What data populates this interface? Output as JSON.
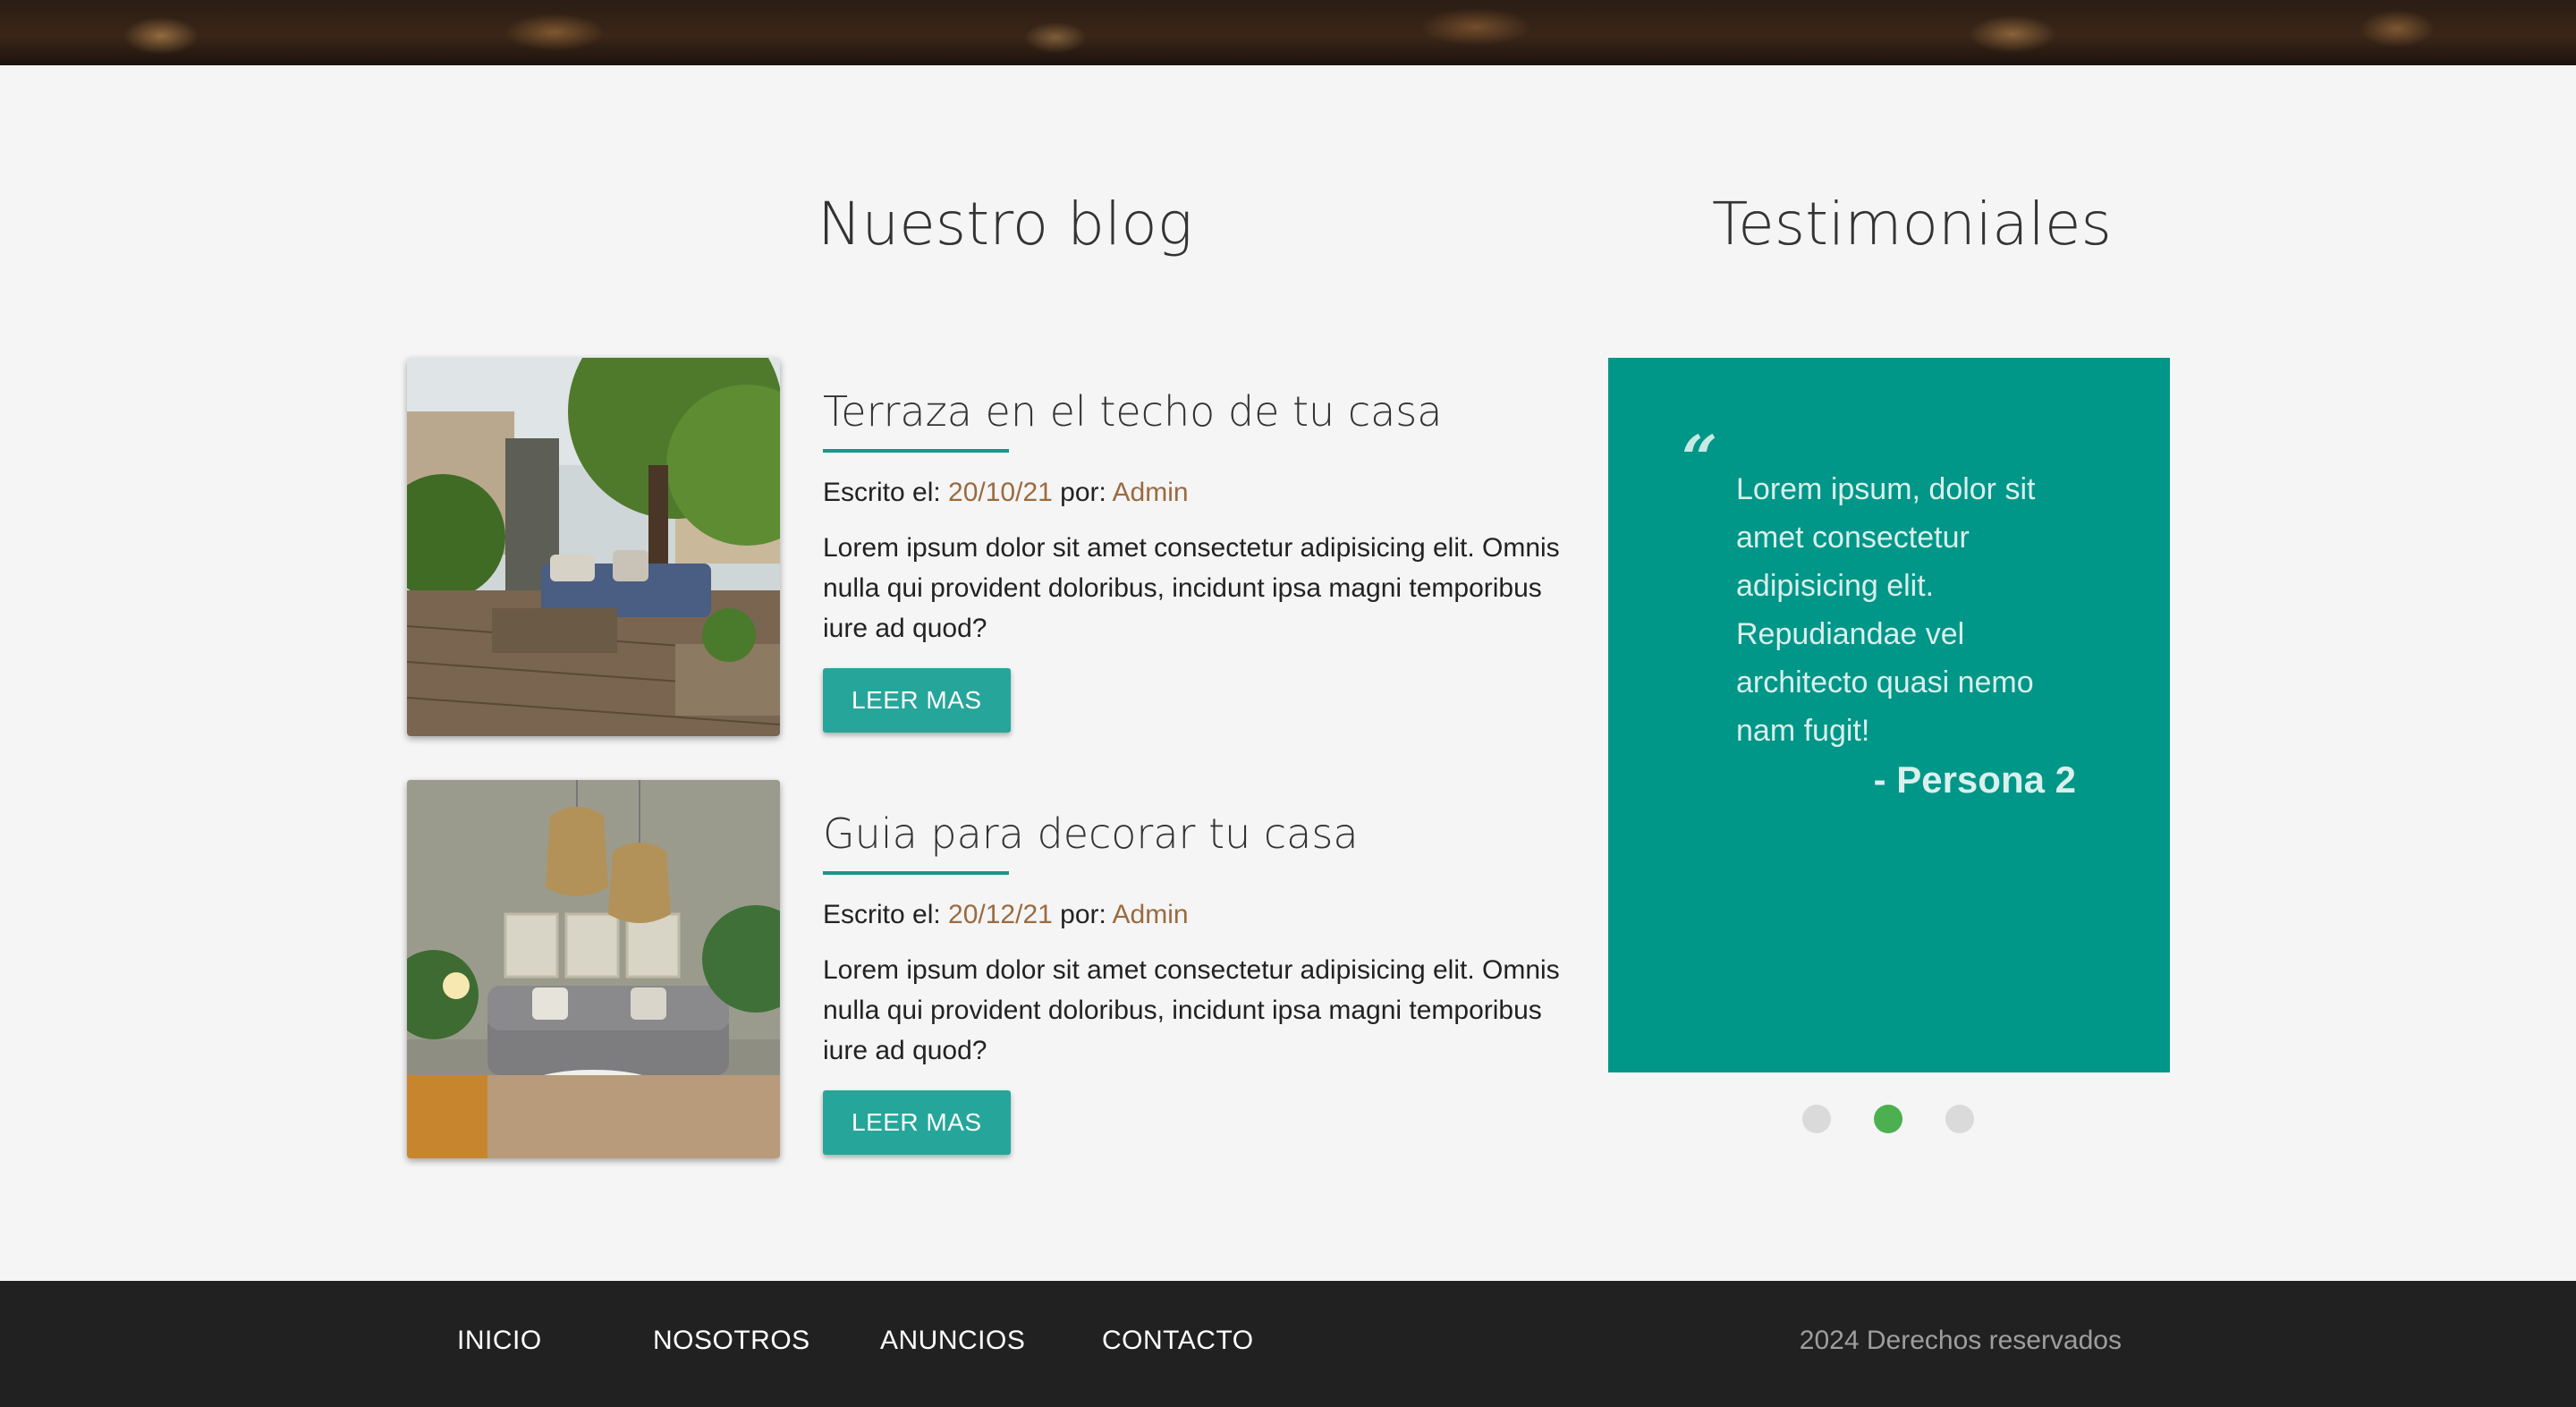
{
  "blog": {
    "title": "Nuestro blog",
    "posts": [
      {
        "heading": "Terraza en el techo de tu casa",
        "meta_prefix": "Escrito el: ",
        "date": "20/10/21",
        "by": " por: ",
        "author": "Admin",
        "text": "Lorem ipsum dolor sit amet consectetur adipisicing elit. Omnis nulla qui provident doloribus, incidunt ipsa magni temporibus iure ad quod?",
        "button": "LEER MAS"
      },
      {
        "heading": "Guia para decorar tu casa",
        "meta_prefix": "Escrito el: ",
        "date": "20/12/21",
        "by": " por: ",
        "author": "Admin",
        "text": "Lorem ipsum dolor sit amet consectetur adipisicing elit. Omnis nulla qui provident doloribus, incidunt ipsa magni temporibus iure ad quod?",
        "button": "LEER MAS"
      }
    ]
  },
  "testimonials": {
    "title": "Testimoniales",
    "quote_mark": "“",
    "quote": "Lorem ipsum, dolor sit amet consectetur adipisicing elit. Repudiandae vel architecto quasi nemo nam fugit!",
    "author": "- Persona 2",
    "active_slide": 2,
    "slide_count": 3
  },
  "footer": {
    "nav": [
      "INICIO",
      "NOSOTROS",
      "ANUNCIOS",
      "CONTACTO"
    ],
    "copyright": "2024 Derechos reservados"
  },
  "colors": {
    "accent": "#26a69a",
    "card": "#009688",
    "meta": "#9b6a3f",
    "dot_active": "#4caf50",
    "footer": "#212121"
  }
}
